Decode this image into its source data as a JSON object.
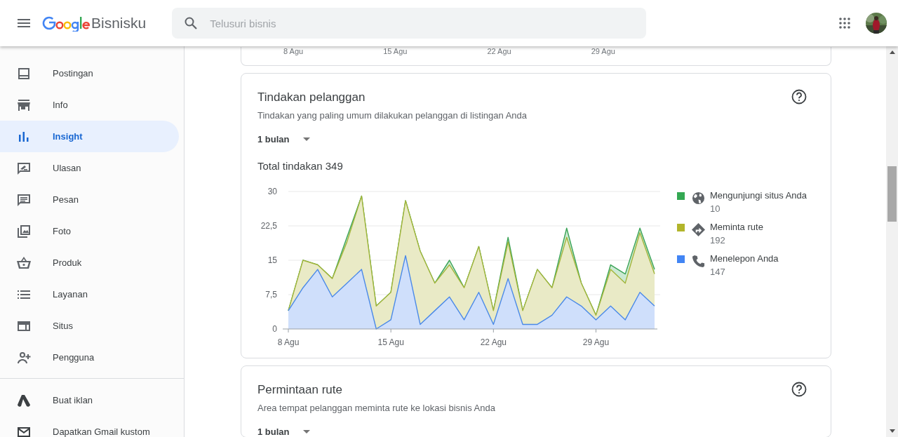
{
  "header": {
    "app_name": "Bisnisku",
    "search": {
      "placeholder": "Telusuri bisnis"
    }
  },
  "sidebar": {
    "items": [
      {
        "label": "Postingan",
        "selected": false
      },
      {
        "label": "Info",
        "selected": false
      },
      {
        "label": "Insight",
        "selected": true
      },
      {
        "label": "Ulasan",
        "selected": false
      },
      {
        "label": "Pesan",
        "selected": false
      },
      {
        "label": "Foto",
        "selected": false
      },
      {
        "label": "Produk",
        "selected": false
      },
      {
        "label": "Layanan",
        "selected": false
      },
      {
        "label": "Situs",
        "selected": false
      },
      {
        "label": "Pengguna",
        "selected": false
      }
    ],
    "extra_items": [
      {
        "label": "Buat iklan"
      },
      {
        "label": "Dapatkan Gmail kustom"
      }
    ]
  },
  "previous_card": {
    "x_labels": [
      "8 Agu",
      "15 Agu",
      "22 Agu",
      "29 Agu"
    ]
  },
  "customer_actions": {
    "title": "Tindakan pelanggan",
    "subtitle": "Tindakan yang paling umum dilakukan pelanggan di listingan Anda",
    "period": "1 bulan",
    "total_label": "Total tindakan 349",
    "legend": [
      {
        "count": "10",
        "color": "#34a853"
      },
      {
        "count": "192",
        "color": "#b2b52b"
      },
      {
        "count": "147",
        "color": "#4285f4"
      }
    ],
    "chart_data": {
      "type": "area",
      "stacked": true,
      "grid": true,
      "categories": [
        "8 Agu",
        null,
        null,
        null,
        null,
        null,
        null,
        "15 Agu",
        null,
        null,
        null,
        null,
        null,
        null,
        "22 Agu",
        null,
        null,
        null,
        null,
        null,
        null,
        "29 Agu",
        null,
        null,
        null,
        null
      ],
      "series": [
        {
          "name": "Menelepon Anda",
          "color": "#4285f4",
          "values": [
            4,
            9,
            13,
            7,
            10,
            13,
            0,
            2,
            16,
            1,
            4,
            7,
            2,
            8,
            1,
            11,
            1,
            1,
            3,
            7,
            5,
            2,
            5,
            2,
            8,
            5
          ]
        },
        {
          "name": "Meminta rute",
          "color": "#b2b52b",
          "values": [
            0,
            6,
            1,
            4,
            9,
            16,
            5,
            6,
            12,
            16,
            6,
            7,
            7,
            10,
            3,
            8,
            3,
            12,
            6,
            13,
            5,
            1,
            8,
            8,
            13,
            7
          ]
        },
        {
          "name": "Mengunjungi situs Anda",
          "color": "#34a853",
          "values": [
            0,
            0,
            0,
            0,
            1,
            0,
            0,
            0,
            0,
            0,
            0,
            1,
            0,
            0,
            0,
            1,
            0,
            0,
            0,
            2,
            0,
            0,
            1,
            2,
            1,
            1
          ]
        }
      ],
      "ylim": [
        0,
        30
      ],
      "yticks": [
        0,
        {
          "value": 7.5,
          "label": "7,5"
        },
        15,
        {
          "value": 22.5,
          "label": "22,5"
        },
        30
      ]
    }
  },
  "route_requests": {
    "title": "Permintaan rute",
    "subtitle": "Area tempat pelanggan meminta rute ke lokasi bisnis Anda",
    "period": "1 bulan"
  }
}
